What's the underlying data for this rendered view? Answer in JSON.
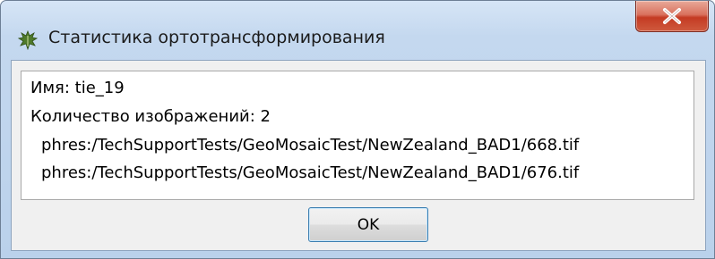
{
  "window": {
    "title": "Статистика ортотрансформирования",
    "app_icon": "leaf-icon",
    "close_icon": "close-icon"
  },
  "info": {
    "name_line": "Имя: tie_19",
    "count_line": "Количество изображений: 2",
    "paths": [
      "phres:/TechSupportTests/GeoMosaicTest/NewZealand_BAD1/668.tif",
      "phres:/TechSupportTests/GeoMosaicTest/NewZealand_BAD1/676.tif"
    ]
  },
  "buttons": {
    "ok_label": "OK"
  },
  "colors": {
    "close_button": "#c43b23",
    "titlebar": "#c4d8ef",
    "focus_border": "#3c7fb1"
  }
}
